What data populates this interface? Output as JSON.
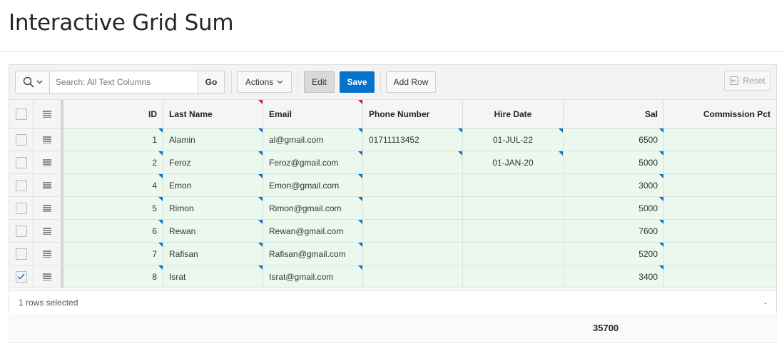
{
  "page": {
    "title": "Interactive Grid Sum"
  },
  "toolbar": {
    "search_placeholder": "Search: All Text Columns",
    "go_label": "Go",
    "actions_label": "Actions",
    "edit_label": "Edit",
    "save_label": "Save",
    "add_row_label": "Add Row",
    "reset_label": "Reset"
  },
  "columns": [
    "ID",
    "Last Name",
    "Email",
    "Phone Number",
    "Hire Date",
    "Sal",
    "Commission Pct"
  ],
  "rows": [
    {
      "id": "1",
      "last_name": "Alamin",
      "email": "al@gmail.com",
      "phone": "01711113452",
      "hire_date": "01-JUL-22",
      "sal": "6500",
      "commission": "",
      "selected": false
    },
    {
      "id": "2",
      "last_name": "Feroz",
      "email": "Feroz@gmail.com",
      "phone": "",
      "hire_date": "01-JAN-20",
      "sal": "5000",
      "commission": "",
      "selected": false
    },
    {
      "id": "4",
      "last_name": "Emon",
      "email": "Emon@gmail.com",
      "phone": "",
      "hire_date": "",
      "sal": "3000",
      "commission": "",
      "selected": false
    },
    {
      "id": "5",
      "last_name": "Rimon",
      "email": "Rimon@gmail.com",
      "phone": "",
      "hire_date": "",
      "sal": "5000",
      "commission": "",
      "selected": false
    },
    {
      "id": "6",
      "last_name": "Rewan",
      "email": "Rewan@gmail.com",
      "phone": "",
      "hire_date": "",
      "sal": "7600",
      "commission": "",
      "selected": false
    },
    {
      "id": "7",
      "last_name": "Rafisan",
      "email": "Rafisan@gmail.com",
      "phone": "",
      "hire_date": "",
      "sal": "5200",
      "commission": "",
      "selected": false
    },
    {
      "id": "8",
      "last_name": "Israt",
      "email": "Israt@gmail.com",
      "phone": "",
      "hire_date": "",
      "sal": "3400",
      "commission": "",
      "selected": true
    }
  ],
  "footer": {
    "status": "1 rows selected",
    "pagination": "-"
  },
  "summary": {
    "sal_total": "35700"
  },
  "colors": {
    "accent": "#0572ce",
    "row_bg": "#ecf8ee",
    "changed_marker": "#d02020"
  },
  "icons": [
    "search-icon",
    "chevron-down-icon",
    "row-menu-icon",
    "checkbox-icon",
    "reset-icon"
  ]
}
